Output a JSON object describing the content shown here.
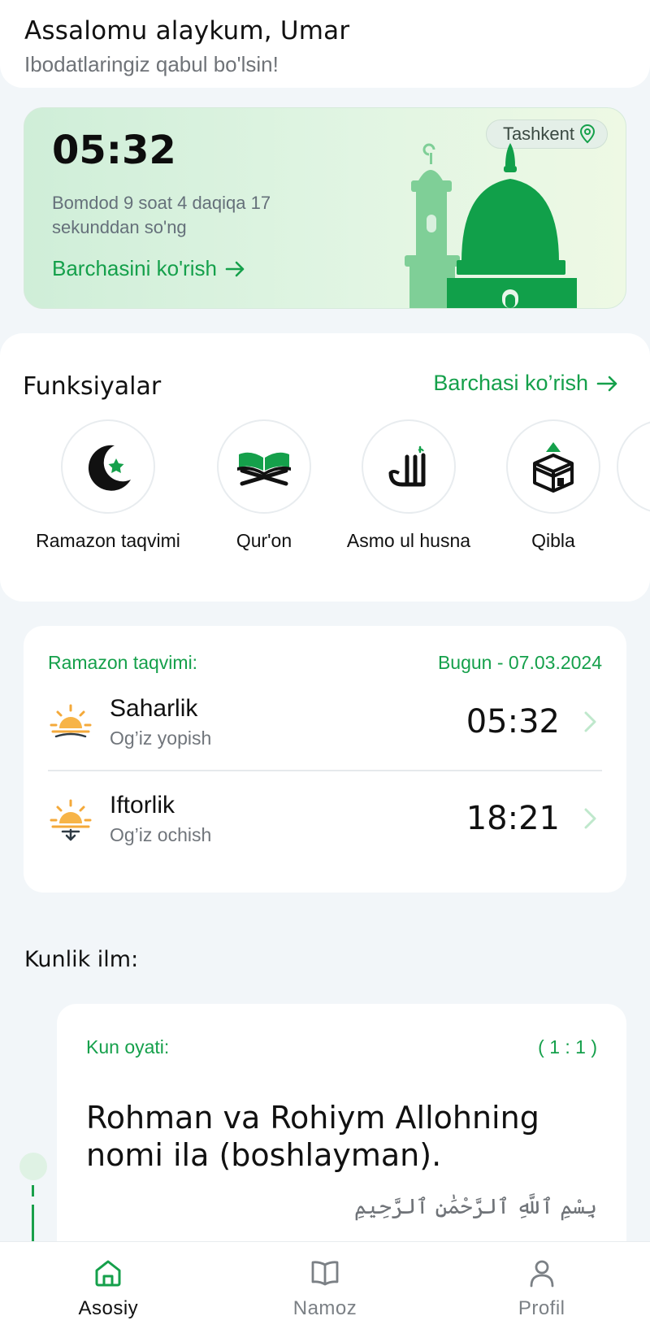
{
  "header": {
    "greeting": "Assalomu alaykum, Umar",
    "subtitle": "Ibodatlaringiz qabul bo'lsin!"
  },
  "prayer": {
    "time": "05:32",
    "countdown": "Bomdod 9 soat 4 daqiqa 17 sekunddan so'ng",
    "see_all": "Barchasini ko'rish",
    "location": "Tashkent",
    "accent_color": "#15a04b"
  },
  "functions": {
    "title": "Funksiyalar",
    "see_all": "Barchasi ko’rish",
    "items": [
      {
        "label": "Ramazon taqvimi",
        "icon": "crescent-star-icon"
      },
      {
        "label": "Qur'on",
        "icon": "quran-book-icon"
      },
      {
        "label": "Asmo ul husna",
        "icon": "allah-calligraphy-icon"
      },
      {
        "label": "Qibla",
        "icon": "kaaba-icon"
      }
    ]
  },
  "ramazon": {
    "title": "Ramazon taqvimi:",
    "date": "Bugun - 07.03.2024",
    "rows": [
      {
        "name": "Saharlik",
        "sub": "Og’iz yopish",
        "time": "05:32",
        "icon": "sunrise-icon"
      },
      {
        "name": "Iftorlik",
        "sub": "Og’iz ochish",
        "time": "18:21",
        "icon": "sunset-icon"
      }
    ]
  },
  "kunlik": {
    "title": "Kunlik ilm:",
    "card": {
      "label": "Kun oyati:",
      "ref": "( 1 : 1 )",
      "text": "Rohman va Rohiym Allohning nomi ila (boshlayman).",
      "arabic": "بِسْمِ ٱللَّهِ ٱلرَّحْمَٰنِ ٱلرَّحِيمِ"
    }
  },
  "nav": {
    "items": [
      {
        "label": "Asosiy",
        "icon": "home-icon",
        "active": true
      },
      {
        "label": "Namoz",
        "icon": "book-icon",
        "active": false
      },
      {
        "label": "Profil",
        "icon": "user-icon",
        "active": false
      }
    ]
  }
}
